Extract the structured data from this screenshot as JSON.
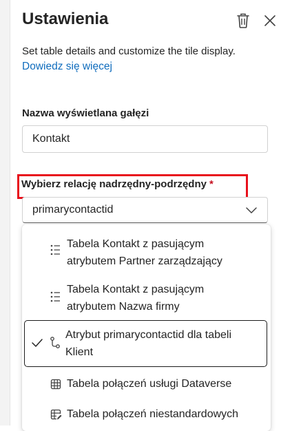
{
  "panel": {
    "title": "Ustawienia",
    "delete_icon": "trash-icon",
    "close_icon": "close-icon",
    "description": "Set table details and customize the tile display.",
    "learn_more": "Dowiedz się więcej"
  },
  "branch_name": {
    "label": "Nazwa wyświetlana gałęzi",
    "value": "Kontakt"
  },
  "relationship": {
    "label": "Wybierz relację nadrzędny-podrzędny",
    "required_mark": "*",
    "selected_value": "primarycontactid",
    "chevron_icon": "chevron-down-icon"
  },
  "options": [
    {
      "line1": "Tabela Kontakt z pasującym",
      "line2": "atrybutem Partner zarządzający",
      "icon": "list-icon",
      "selected": false
    },
    {
      "line1": "Tabela Kontakt z pasującym",
      "line2": "atrybutem Nazwa firmy",
      "icon": "list-icon",
      "selected": false
    },
    {
      "line1": "Atrybut primarycontactid dla tabeli",
      "line2": "Klient",
      "icon": "branch-icon",
      "selected": true
    },
    {
      "line1": "Tabela połączeń usługi Dataverse",
      "icon": "table-icon",
      "selected": false
    },
    {
      "line1": "Tabela połączeń niestandardowych",
      "icon": "table-edit-icon",
      "selected": false
    }
  ],
  "colors": {
    "accent_link": "#0f6cbd",
    "highlight_border": "#e8101c",
    "required": "#c50f1f"
  }
}
